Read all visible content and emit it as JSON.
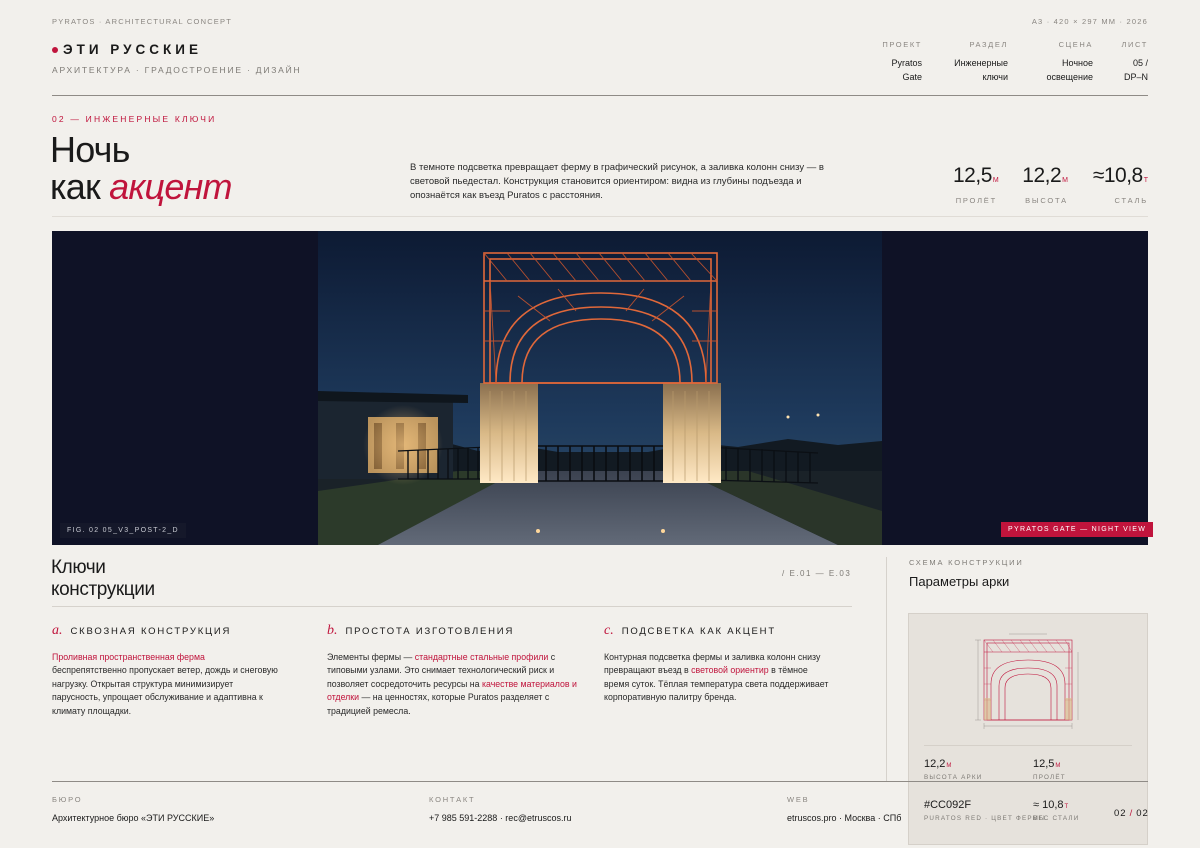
{
  "top": {
    "left_meta": "PYRATOS · ARCHITECTURAL CONCEPT",
    "right_meta": "A3 · 420 × 297 MM · 2026"
  },
  "brand": {
    "name": "ЭТИ РУССКИЕ",
    "subtitle": "АРХИТЕКТУРА · ГРАДОСТРОЕНИЕ · ДИЗАЙН"
  },
  "info": [
    {
      "label": "ПРОЕКТ",
      "line1": "Pyratos",
      "line2": "Gate"
    },
    {
      "label": "РАЗДЕЛ",
      "line1": "Инженерные",
      "line2": "ключи"
    },
    {
      "label": "СЦЕНА",
      "line1": "Ночное",
      "line2": "освещение"
    },
    {
      "label": "ЛИСТ",
      "line1": "05 /",
      "line2": "DP–N"
    }
  ],
  "section": {
    "label": "02 — ИНЖЕНЕРНЫЕ КЛЮЧИ",
    "title_line1": "Ночь",
    "title_line2_plain": "как ",
    "title_line2_accent": "акцент",
    "lead": "В темноте подсветка превращает ферму в графический рисунок, а заливка колонн снизу — в световой пьедестал. Конструкция становится ориентиром: видна из глубины подъезда и опознаётся как въезд Puratos с расстояния."
  },
  "stats": [
    {
      "value": "12,5",
      "unit": "М",
      "label": "ПРОЛЁТ"
    },
    {
      "value": "12,2",
      "unit": "М",
      "label": "ВЫСОТА"
    },
    {
      "value": "≈10,8",
      "unit": "Т",
      "label": "СТАЛЬ"
    }
  ],
  "hero": {
    "fig_caption": "FIG. 02   05_V3_POST-2_D",
    "tag": "PYRATOS GATE — NIGHT VIEW"
  },
  "keys": {
    "title_line1": "Ключи",
    "title_line2": "конструкции",
    "code": "/ E.01 — E.03",
    "items": [
      {
        "letter": "a.",
        "title": "СКВОЗНАЯ КОНСТРУКЦИЯ",
        "hl": "Проливная пространственная ферма",
        "text": " беспрепятственно пропускает ветер, дождь и снеговую нагрузку. Открытая структура минимизирует парусность, упрощает обслуживание и адаптивна к климату площадки."
      },
      {
        "letter": "b.",
        "title": "ПРОСТОТА ИЗГОТОВЛЕНИЯ",
        "pre": "Элементы фермы — ",
        "hl1": "стандартные стальные профили",
        "mid": " с типовыми узлами. Это снимает технологический риск и позволяет сосредоточить ресурсы на ",
        "hl2": "качестве материалов и отделки",
        "post": " — на ценностях, которые Puratos разделяет с традицией ремесла."
      },
      {
        "letter": "c.",
        "title": "ПОДСВЕТКА КАК АКЦЕНТ",
        "pre": "Контурная подсветка фермы и заливка колонн снизу превращают въезд в ",
        "hl": "световой ориентир",
        "post": " в тёмное время суток. Тёплая температура света поддерживает корпоративную палитру бренда."
      }
    ]
  },
  "scheme": {
    "label": "СХЕМА КОНСТРУКЦИИ",
    "title": "Параметры арки",
    "specs": [
      {
        "value": "12,2",
        "unit": "М",
        "label": "ВЫСОТА АРКИ"
      },
      {
        "value": "12,5",
        "unit": "М",
        "label": "ПРОЛЁТ"
      },
      {
        "value": "#CC092F",
        "unit": "",
        "label": "PURATOS RED · ЦВЕТ ФЕРМЫ"
      },
      {
        "value": "≈ 10,8",
        "unit": "Т",
        "label": "ВЕС СТАЛИ"
      }
    ]
  },
  "footer": {
    "bureau_label": "БЮРО",
    "bureau": "Архитектурное бюро «ЭТИ РУССКИЕ»",
    "contact_label": "КОНТАКТ",
    "contact": "+7 985 591-2288 · rec@etruscos.ru",
    "web_label": "WEB",
    "web": "etruscos.pro · Москва · СПб",
    "page_current": "02",
    "page_total": "02"
  },
  "colors": {
    "accent": "#C0143C",
    "background": "#F2F0EC",
    "hero_bg": "#0F1226"
  }
}
